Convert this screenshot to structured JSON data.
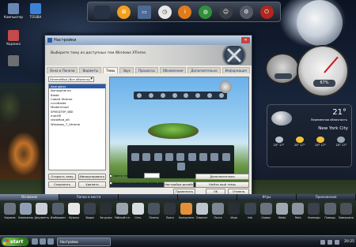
{
  "desktop": {
    "icons": [
      {
        "label": "Компьютер",
        "icon": "computer-icon",
        "color": "#6a86b3"
      },
      {
        "label": "TOSIBA",
        "icon": "folder-icon",
        "color": "#3b82d6"
      },
      {
        "label": "Корзина",
        "icon": "recycle-bin-icon",
        "color": "#c34a4a"
      },
      {
        "label": "",
        "icon": "folder-icon",
        "color": "#6d6f73"
      }
    ]
  },
  "top_dock": {
    "items": [
      {
        "icon": "badge-icon",
        "color": "#273246",
        "glyph": ""
      },
      {
        "icon": "windows-icon",
        "color": "#f0a020",
        "glyph": "⊞"
      },
      {
        "icon": "monitor-icon",
        "color": "#4c6a94",
        "glyph": "▭"
      },
      {
        "icon": "clock-icon",
        "color": "#e8e8e8",
        "glyph": "◷"
      },
      {
        "icon": "info-icon",
        "color": "#e07b1c",
        "glyph": "i"
      },
      {
        "icon": "globe-icon",
        "color": "#2f8f3a",
        "glyph": "◍"
      },
      {
        "icon": "user-icon",
        "color": "#3a3f47",
        "glyph": "☺"
      },
      {
        "icon": "gear-icon",
        "color": "#555b66",
        "glyph": "⚙"
      },
      {
        "icon": "power-icon",
        "color": "#b1261e",
        "glyph": "⏻"
      }
    ]
  },
  "gauges": {
    "cpu_label": "67%",
    "mem_label": "",
    "cpu_fraction": 0.67
  },
  "weather": {
    "temperature": "21°",
    "condition": "Переменная облачность",
    "city": "New York City",
    "forecast": [
      {
        "temps": "25° 17°",
        "icon": "cloud-icon",
        "color": "#b9c3cf"
      },
      {
        "temps": "25° 17°",
        "icon": "sun-icon",
        "color": "#f2c23a"
      },
      {
        "temps": "25° 17°",
        "icon": "sun-icon",
        "color": "#f2c23a"
      },
      {
        "temps": "25° 17°",
        "icon": "cloud-rain-icon",
        "color": "#9aa6b4"
      }
    ]
  },
  "dialog": {
    "title": "Настройки",
    "header_text": "Выберите тему из доступных тем Windows XTreme.",
    "close_glyph": "✕",
    "tabs": [
      {
        "label": "Окна и Панели",
        "active": false
      },
      {
        "label": "Виджеты",
        "active": false
      },
      {
        "label": "Темы",
        "active": true
      },
      {
        "label": "Звук",
        "active": false
      },
      {
        "label": "Процессы",
        "active": false
      },
      {
        "label": "Обновления",
        "active": false
      },
      {
        "label": "Дополнительно",
        "active": false
      },
      {
        "label": "Информация",
        "active": false
      }
    ],
    "theme_filter": "XtremeMod (Все объекты)",
    "themes": [
      {
        "name": "Aeonglass",
        "selected": true
      },
      {
        "name": "Atmospherics",
        "selected": false
      },
      {
        "name": "Blade",
        "selected": false
      },
      {
        "name": "Cobalt Xtreme",
        "selected": false
      },
      {
        "name": "Lucidtaste",
        "selected": false
      },
      {
        "name": "Modernmod",
        "selected": false
      },
      {
        "name": "SPEEDTEP_BSE",
        "selected": false
      },
      {
        "name": "mac08",
        "selected": false
      },
      {
        "name": "vistaMod_alt",
        "selected": false
      },
      {
        "name": "Windows_7_Xtreme",
        "selected": false
      }
    ],
    "buttons": {
      "open_theme": "Открыть тему",
      "import": "Импортировать",
      "save": "Сохранить",
      "delete": "Удалить",
      "extra": "Дополнительно",
      "backup": "Настройки дизайна",
      "find_themes": "Найти ещё темы",
      "apply": "Применить",
      "ok": "OK",
      "cancel": "Отмена"
    },
    "checkboxes": {
      "theme_color": "Цвета темы:",
      "enable_video": "Включить поддержку Video Ideas"
    }
  },
  "dock": {
    "tabs": [
      {
        "label": "Основное",
        "active": true
      },
      {
        "label": "Папки и места",
        "active": false
      },
      {
        "label": "",
        "active": false
      },
      {
        "label": "",
        "active": false
      },
      {
        "label": "Игры",
        "active": false
      },
      {
        "label": "Приложения",
        "active": false
      }
    ],
    "items": [
      {
        "label": "Корзина",
        "icon": "gear-icon",
        "color": "#6b7480"
      },
      {
        "label": "Компьютер",
        "icon": "recycle-bin-icon",
        "color": "#8fa0b6"
      },
      {
        "label": "Документы",
        "icon": "documents-icon",
        "color": "#c9cfd6"
      },
      {
        "label": "Изображения",
        "icon": "pictures-icon",
        "color": "#55606e"
      },
      {
        "label": "Музыка",
        "icon": "music-icon",
        "color": "#e8e8e8"
      },
      {
        "label": "Видео",
        "icon": "video-icon",
        "color": "#3b4350"
      },
      {
        "label": "Загрузки",
        "icon": "downloads-icon",
        "color": "#2b2f36"
      },
      {
        "label": "Рабочий стол",
        "icon": "desktop-icon",
        "color": "#9aa3ae"
      },
      {
        "label": "Сеть",
        "icon": "network-icon",
        "color": "#d8dde2"
      },
      {
        "label": "Панель",
        "icon": "panel-icon",
        "color": "#4a5360"
      },
      {
        "label": "Поиск",
        "icon": "search-icon",
        "color": "#31363e"
      },
      {
        "label": "Калькулятор",
        "icon": "calculator-icon",
        "color": "#e2913a"
      },
      {
        "label": "Блокнот",
        "icon": "notepad-icon",
        "color": "#c0c6cd"
      },
      {
        "label": "Почта",
        "icon": "mail-icon",
        "color": "#7d8793"
      },
      {
        "label": "Игры",
        "icon": "games-icon",
        "color": "#2a2e35"
      },
      {
        "label": "Info",
        "icon": "info-icon",
        "color": "#3c4552"
      },
      {
        "label": "Сервис",
        "icon": "tools-icon",
        "color": "#6a737f"
      },
      {
        "label": "Media",
        "icon": "media-icon",
        "color": "#a0a8b2"
      },
      {
        "label": "Paint",
        "icon": "paint-icon",
        "color": "#8b949f"
      },
      {
        "label": "Команды",
        "icon": "terminal-icon",
        "color": "#3a414b"
      },
      {
        "label": "Помощь",
        "icon": "help-icon",
        "color": "#5c6470"
      },
      {
        "label": "Завершение",
        "icon": "shutdown-icon",
        "color": "#4a5158"
      }
    ]
  },
  "taskbar": {
    "start_label": "start",
    "task_label": "Настройки",
    "clock": "20:25"
  }
}
